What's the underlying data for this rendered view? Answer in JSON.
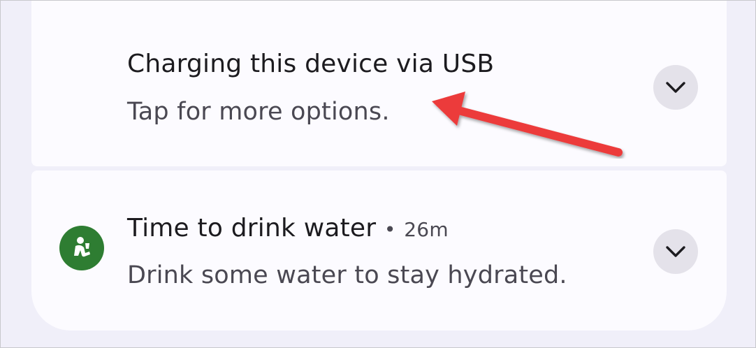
{
  "notifications": [
    {
      "title": "Charging this device via USB",
      "subtitle": "Tap for more options.",
      "expand_icon": "chevron-down-icon"
    },
    {
      "app_icon": "drinking-person-icon",
      "title": "Time to drink water",
      "separator": "•",
      "time": "26m",
      "subtitle": "Drink some water to stay hydrated.",
      "expand_icon": "chevron-down-icon"
    }
  ],
  "colors": {
    "background": "#f0eff9",
    "card": "#fcfbff",
    "app_icon": "#2e7d32",
    "annotation_arrow": "#ec3b3b"
  }
}
